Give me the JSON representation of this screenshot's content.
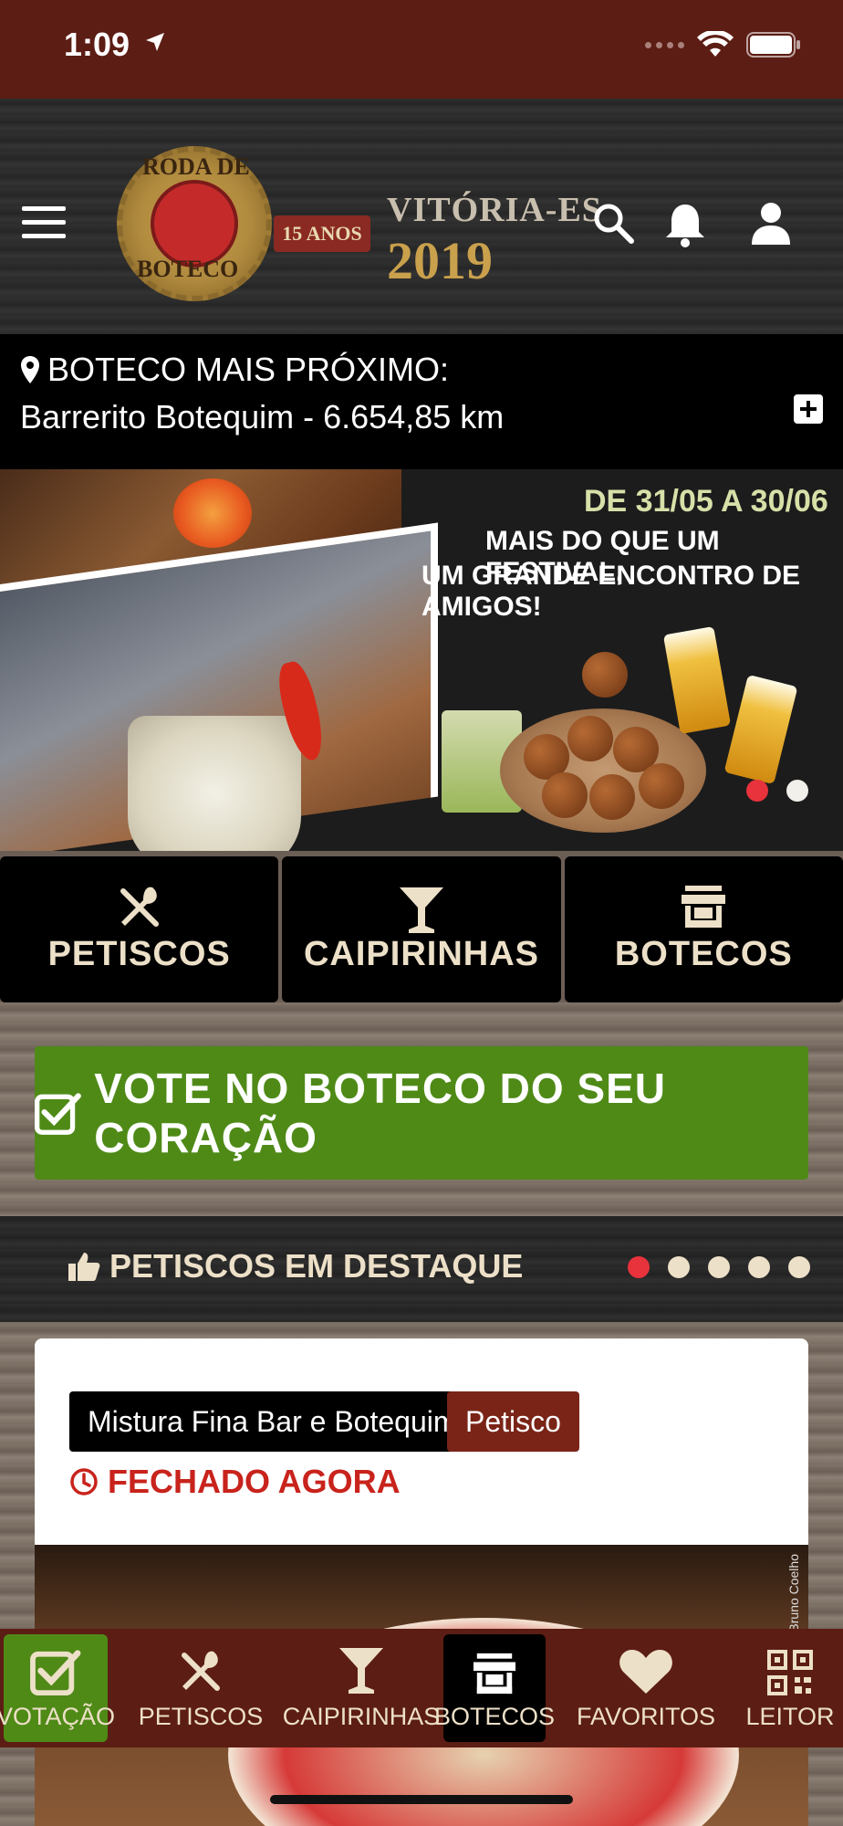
{
  "status_bar": {
    "time": "1:09"
  },
  "header": {
    "logo_line1": "RODA DE",
    "logo_line2": "BOTECO",
    "logo_anos": "15 ANOS",
    "logo_city": "VITÓRIA-ES",
    "logo_year": "2019"
  },
  "nearest": {
    "title": "BOTECO MAIS PRÓXIMO:",
    "value": "Barrerito Botequim - 6.654,85 km"
  },
  "banner": {
    "dates": "DE 31/05 A 30/06",
    "line1": "MAIS DO QUE UM FESTIVAL,",
    "line2": "UM GRANDE ENCONTRO DE AMIGOS!",
    "slide_count": 2,
    "active_slide": 1
  },
  "categories": [
    {
      "label": "PETISCOS",
      "icon": "utensils-icon"
    },
    {
      "label": "CAIPIRINHAS",
      "icon": "cocktail-icon"
    },
    {
      "label": "BOTECOS",
      "icon": "store-icon"
    }
  ],
  "vote": {
    "label": "VOTE NO BOTECO DO SEU CORAÇÃO"
  },
  "featured": {
    "title": "PETISCOS EM DESTAQUE",
    "slide_count": 5,
    "active_slide": 1
  },
  "card": {
    "bar_name": "Mistura Fina Bar e Botequim",
    "type": "Petisco",
    "status": "FECHADO AGORA",
    "photo_credit": "Bruno Coelho"
  },
  "tabbar": [
    {
      "label": "VOTAÇÃO",
      "icon": "check-square-icon",
      "state": "vote"
    },
    {
      "label": "PETISCOS",
      "icon": "utensils-icon",
      "state": "normal"
    },
    {
      "label": "CAIPIRINHAS",
      "icon": "cocktail-icon",
      "state": "normal"
    },
    {
      "label": "BOTECOS",
      "icon": "store-icon",
      "state": "selected"
    },
    {
      "label": "FAVORITOS",
      "icon": "heart-icon",
      "state": "normal"
    },
    {
      "label": "LEITOR",
      "icon": "qrcode-icon",
      "state": "normal"
    }
  ],
  "colors": {
    "brand_dark_red": "#5c1d14",
    "vote_green": "#4f8a17",
    "accent_red": "#c8231c",
    "cream": "#ede0c8"
  }
}
